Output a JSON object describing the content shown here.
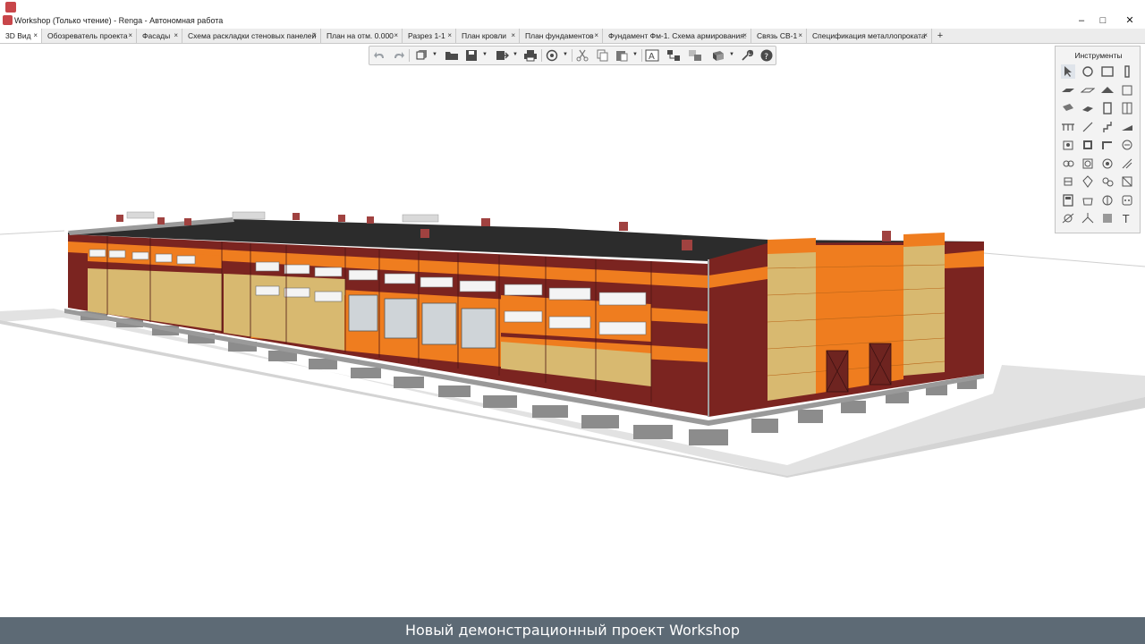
{
  "window": {
    "title": "Workshop (Только чтение) - Renga - Автономная работа",
    "minimize_glyph": "–",
    "maximize_glyph": "□",
    "close_glyph": "✕"
  },
  "tabs": [
    {
      "label": "3D Вид",
      "active": true
    },
    {
      "label": "Обозреватель проекта"
    },
    {
      "label": "Фасады"
    },
    {
      "label": "Схема раскладки стеновых панелей"
    },
    {
      "label": "План на отм. 0.000"
    },
    {
      "label": "Разрез 1-1"
    },
    {
      "label": "План кровли"
    },
    {
      "label": "План фундаментов"
    },
    {
      "label": "Фундамент Фм-1. Схема армирования."
    },
    {
      "label": "Связь СВ-1"
    },
    {
      "label": "Спецификация металлопроката"
    }
  ],
  "tab_close_glyph": "×",
  "tab_add_glyph": "+",
  "toolbar": {
    "icons": [
      "undo-icon",
      "redo-icon",
      "view-cube-icon",
      "open-folder-icon",
      "save-icon",
      "export-icon",
      "print-icon",
      "snap-icon",
      "cut-icon",
      "copy-icon",
      "paste-icon",
      "text-style-icon",
      "layers-icon",
      "link-icon",
      "display-mode-icon",
      "wrench-icon",
      "help-icon"
    ]
  },
  "tools_panel": {
    "title": "Инструменты",
    "icons": [
      "select-tool-icon",
      "rebar-tool-icon",
      "room-tool-icon",
      "column-tool-icon",
      "floor-tool-icon",
      "slab-tool-icon",
      "roof-tool-icon",
      "opening-tool-icon",
      "beam-tool-icon",
      "plate-tool-icon",
      "door-tool-icon",
      "window-tool-icon",
      "railing-tool-icon",
      "line-tool-icon",
      "stair-tool-icon",
      "ramp-tool-icon",
      "equipment-tool-icon",
      "element-tool-icon",
      "route-tool-icon",
      "duct-tool-icon",
      "pipe-fitting-tool-icon",
      "panel-tool-icon",
      "fitting-tool-icon",
      "hatch-tool-icon",
      "manifold-tool-icon",
      "lamp-tool-icon",
      "switch-tool-icon",
      "mechanical-tool-icon",
      "cabinet-tool-icon",
      "sink-tool-icon",
      "terminal-tool-icon",
      "socket-tool-icon",
      "dimension-tool-icon",
      "level-tool-icon",
      "shape-tool-icon",
      "text-tool-icon"
    ]
  },
  "caption": "Новый демонстрационный проект Workshop",
  "colors": {
    "brand": "#c8464a",
    "caption_bar": "#5d6a75",
    "facade_orange": "#ef7d1f",
    "facade_brown": "#7b2420",
    "facade_sand": "#d8b970",
    "roof": "#2c2c2c"
  }
}
